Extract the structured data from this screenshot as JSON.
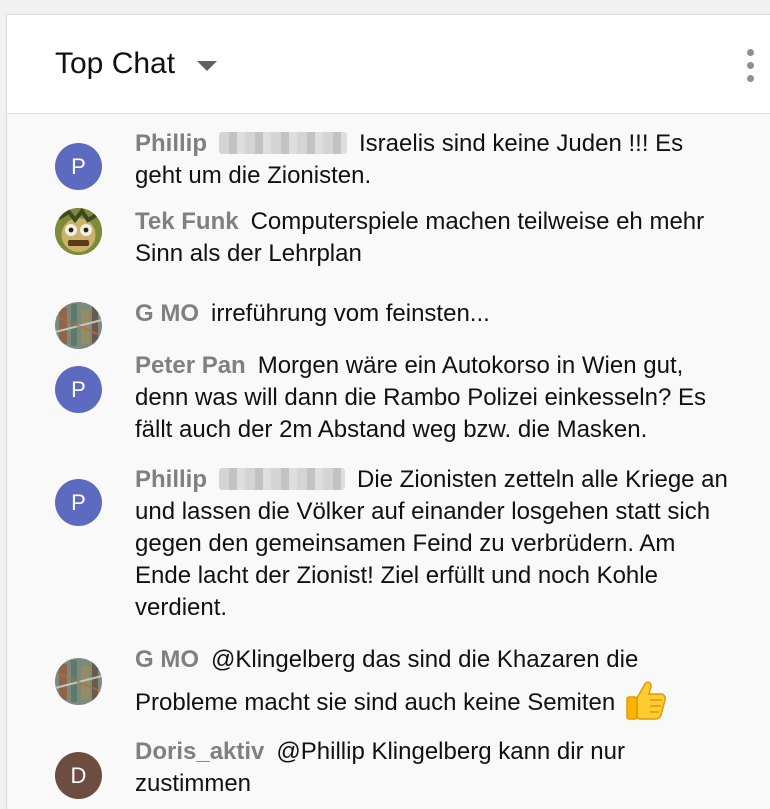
{
  "header": {
    "title": "Top Chat"
  },
  "messages": [
    {
      "author": "Phillip",
      "avatar_letter": "P",
      "redacted_surname": true,
      "text": "Israelis sind keine Juden !!! Es geht um die Zionisten."
    },
    {
      "author": "Tek Funk",
      "avatar": "cartoon-face-image",
      "text": "Computerspiele machen teilweise eh mehr Sinn als der Lehrplan"
    },
    {
      "author": "G MO",
      "avatar": "photo-image",
      "text": "irreführung vom feinsten..."
    },
    {
      "author": "Peter Pan",
      "avatar_letter": "P",
      "text": "Morgen wäre ein Autokorso in Wien gut, denn was will dann die Rambo Polizei einkesseln? Es fällt auch der 2m Abstand weg bzw. die Masken."
    },
    {
      "author": "Phillip",
      "avatar_letter": "P",
      "redacted_surname": true,
      "text": "Die Zionisten zetteln alle Kriege an und lassen die Völker auf einander losgehen statt sich gegen den gemeinsamen Feind zu verbrüdern. Am Ende lacht der Zionist! Ziel erfüllt und noch Kohle verdient."
    },
    {
      "author": "G MO",
      "avatar": "photo-image",
      "text": "@Klingelberg das sind die Khazaren die Probleme macht sie sind auch keine Semiten",
      "emoji": "thumbs-up-emoji"
    },
    {
      "author": "Doris_aktiv",
      "avatar_letter": "D",
      "text": "@Phillip Klingelberg kann dir nur zustimmen"
    }
  ],
  "colors": {
    "avatar_p": "#5c6bc0",
    "avatar_d": "#6d4c41",
    "author": "#808080"
  }
}
